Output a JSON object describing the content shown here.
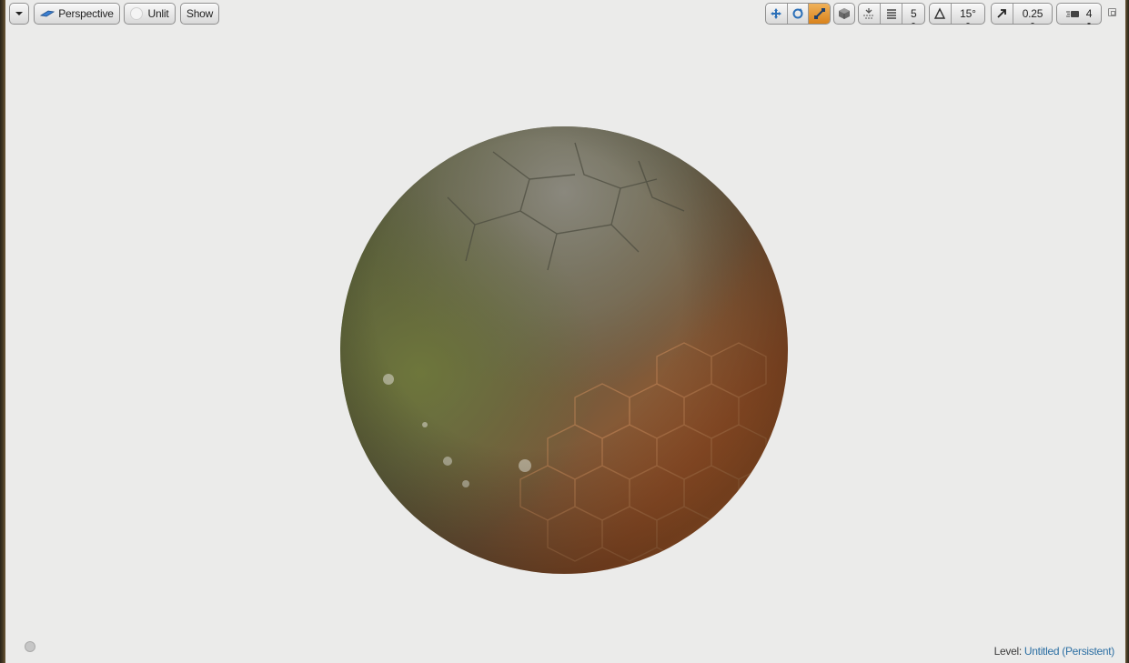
{
  "toolbar_left": {
    "dropdown_icon": "chevron-down-icon",
    "perspective_label": "Perspective",
    "perspective_icon": "perspective-camera-icon",
    "lit_label": "Unlit",
    "show_label": "Show"
  },
  "toolbar_right": {
    "transform_icons": [
      "translate-icon",
      "rotate-icon",
      "scale-icon"
    ],
    "active_tool": "scale",
    "surface_snap_icon": "surface-snapping-icon",
    "grid_icon": "grid-snap-icon",
    "grid_value": "5",
    "rotation_icon": "rotation-snap-icon",
    "rotation_value": "15°",
    "scale_icon": "scale-snap-icon",
    "scale_value": "0.25",
    "camera_speed_icon": "camera-speed-icon",
    "camera_speed_value": "4",
    "maximize_icon": "maximize-viewport-icon"
  },
  "status": {
    "level_label": "Level:",
    "level_name": "Untitled (Persistent)"
  },
  "colors": {
    "accent": "#e0901f",
    "background": "#ebebea",
    "level_link": "#2c6fa3"
  }
}
